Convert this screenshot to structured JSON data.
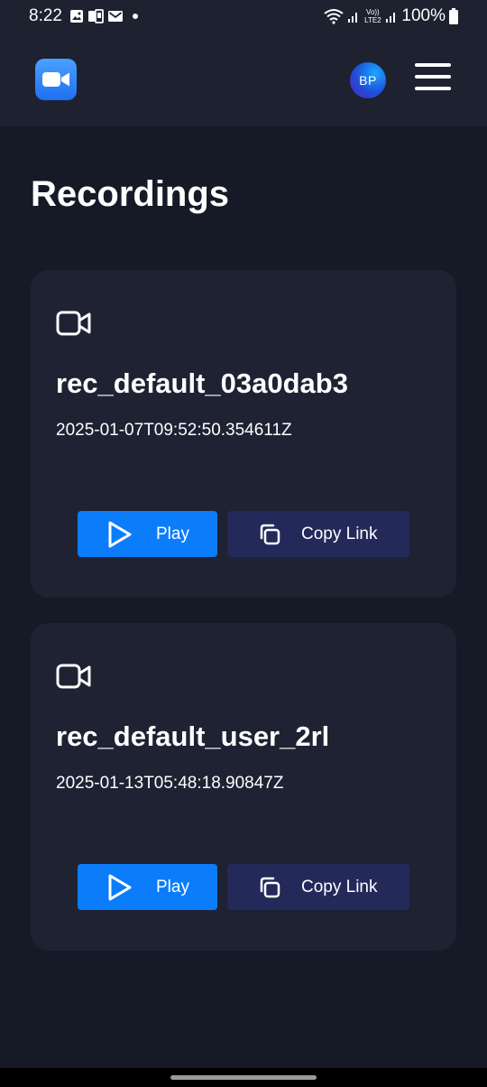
{
  "status_bar": {
    "time": "8:22",
    "network_label": "Vo)) LTE2",
    "battery": "100%"
  },
  "header": {
    "avatar_initials": "BP"
  },
  "page": {
    "title": "Recordings"
  },
  "recordings": [
    {
      "name": "rec_default_03a0dab3",
      "timestamp": "2025-01-07T09:52:50.354611Z",
      "play_label": "Play",
      "copy_label": "Copy Link"
    },
    {
      "name": "rec_default_user_2rl",
      "timestamp": "2025-01-13T05:48:18.90847Z",
      "play_label": "Play",
      "copy_label": "Copy Link"
    }
  ],
  "icons": {
    "logo": "video-camera-logo-icon",
    "card": "video-camera-icon",
    "play": "play-icon",
    "copy": "copy-icon",
    "menu": "hamburger-menu-icon"
  },
  "colors": {
    "background": "#161a27",
    "header": "#1d2130",
    "card": "#1e2233",
    "play_button": "#0b7dfa",
    "copy_button": "#232a5a"
  }
}
